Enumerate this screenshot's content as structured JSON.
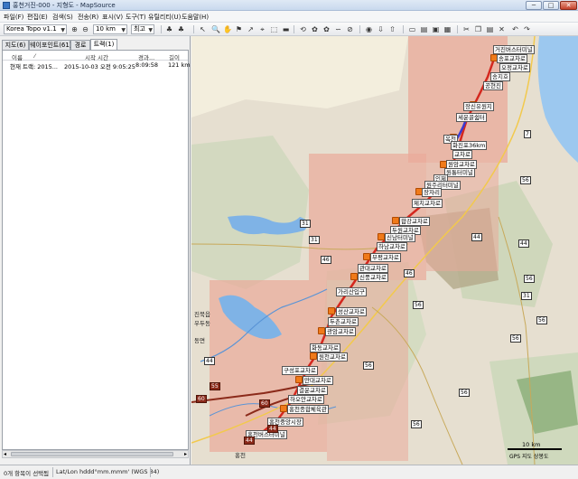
{
  "window": {
    "title": "홍천거진-000 - 지형도 - MapSource",
    "min_label": "─",
    "max_label": "□",
    "close_label": "✕"
  },
  "menu": [
    "파일(F)",
    "편집(E)",
    "검색(S)",
    "전송(R)",
    "표시(V)",
    "도구(T)",
    "유틸리티(U)",
    "도움말(H)"
  ],
  "toolbar": {
    "map_product": "Korea Topo v1.1",
    "zoom_level": "10 km",
    "detail": "최고"
  },
  "left_panel": {
    "tabs": [
      "지도(6)",
      "웨이포인트(61)",
      "경로",
      "트랙(1)"
    ],
    "active_tab": 3,
    "columns": [
      "이름",
      "시작 시간",
      "경과...",
      "길이"
    ],
    "rows": [
      {
        "name": "현재 트랙: 2015...",
        "start": "2015-10-03 오전 9:05:25",
        "elapsed": "8:09:58",
        "length": "121 km"
      }
    ]
  },
  "map": {
    "waypoints": [
      {
        "label": "거진버스터미널"
      },
      {
        "label": "송포교차로"
      },
      {
        "label": "오정교차로"
      },
      {
        "label": "송지호"
      },
      {
        "label": "공현진"
      },
      {
        "label": "장신유원지"
      },
      {
        "label": "세운골쉼터"
      },
      {
        "label": "옥천"
      },
      {
        "label": "화진포36km"
      },
      {
        "label": "교차로"
      },
      {
        "label": "원암교차로"
      },
      {
        "label": "원통터미널"
      },
      {
        "label": "인제"
      },
      {
        "label": "원주리터미널"
      },
      {
        "label": "장자리"
      },
      {
        "label": "제치교차로"
      },
      {
        "label": "합강교차로"
      },
      {
        "label": "두원교차로"
      },
      {
        "label": "신남터미널"
      },
      {
        "label": "하남교차로"
      },
      {
        "label": "부평교차로"
      },
      {
        "label": "관대교차로"
      },
      {
        "label": "신풍교차로"
      },
      {
        "label": "가리산입구"
      },
      {
        "label": "성산교차로"
      },
      {
        "label": "두촌교차로"
      },
      {
        "label": "광암교차로"
      },
      {
        "label": "화동교차로"
      },
      {
        "label": "원천교차로"
      },
      {
        "label": "구성포교차로"
      },
      {
        "label": "만대교차로"
      },
      {
        "label": "결운교차로"
      },
      {
        "label": "하오안교차로"
      },
      {
        "label": "홍천종합체육관"
      },
      {
        "label": "홍천중앙시장"
      },
      {
        "label": "홍천버스터미널"
      }
    ],
    "route_numbers": [
      "7",
      "56",
      "31",
      "31",
      "44",
      "46",
      "44",
      "46",
      "56",
      "31",
      "56",
      "56",
      "56",
      "56",
      "56",
      "44",
      "56",
      "7"
    ],
    "highway_numbers": [
      "55",
      "60",
      "60",
      "44",
      "44"
    ],
    "places": [
      "진북읍",
      "우두동",
      "동면",
      "홍천"
    ],
    "scale_label": "10 km",
    "attribution": "GPS 지도 상봉도"
  },
  "status": {
    "selection": "0개 항목이 선택됨",
    "coords_format": "Lat/Lon hddd°mm.mmm' (WGS 84)"
  },
  "colors": {
    "track": "#d4271e",
    "waypoint": "#f07a1a",
    "sea": "#9cc8ef",
    "relief_pink": "#e9a99a",
    "highway": "#8b2a1a"
  }
}
